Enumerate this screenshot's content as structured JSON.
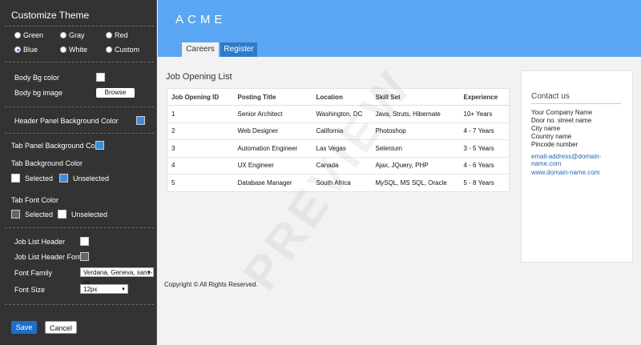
{
  "sidebar": {
    "title": "Customize Theme",
    "themes": [
      {
        "label": "Green",
        "selected": false
      },
      {
        "label": "Gray",
        "selected": false
      },
      {
        "label": "Red",
        "selected": false
      },
      {
        "label": "Blue",
        "selected": true
      },
      {
        "label": "White",
        "selected": false
      },
      {
        "label": "Custom",
        "selected": false
      }
    ],
    "body_bg_color_label": "Body Bg color",
    "body_bg_image_label": "Body bg image",
    "browse_label": "Browse",
    "header_panel_bg_label": "Header Panel Background Color",
    "tab_panel_bg_label": "Tab Panel Background Color",
    "tab_bg_label": "Tab Background Color",
    "selected_label": "Selected",
    "unselected_label": "Unselected",
    "tab_font_color_label": "Tab Font Color",
    "job_list_header_label": "Job List Header",
    "job_list_header_font_label": "Job List Header Font",
    "font_family_label": "Font Family",
    "font_family_value": "Verdana, Geneva, sans-se",
    "font_size_label": "Font Size",
    "font_size_value": "12px",
    "save_label": "Save",
    "cancel_label": "Cancel"
  },
  "colors": {
    "sidebar_bg": "#333333",
    "header_bg": "#5aa6f2",
    "accent_blue": "#3b8de0",
    "white": "#ffffff",
    "gray": "#666666"
  },
  "header": {
    "brand": "ACME",
    "tabs": [
      {
        "label": "Careers",
        "active": true
      },
      {
        "label": "Register",
        "active": false
      }
    ]
  },
  "main": {
    "list_title": "Job Opening List",
    "columns": [
      "Job Opening ID",
      "Posting Title",
      "Location",
      "Skill Set",
      "Experience"
    ],
    "rows": [
      [
        "1",
        "Senior Architect",
        "Washington, DC",
        "Java, Struts, Hibernate",
        "10+ Years"
      ],
      [
        "2",
        "Web Designer",
        "California",
        "Photoshop",
        "4 - 7 Years"
      ],
      [
        "3",
        "Automation Engineer",
        "Las Vegas",
        "Selenium",
        "3 - 5 Years"
      ],
      [
        "4",
        "UX Engineer",
        "Canada",
        "Ajax, JQuery, PHP",
        "4 - 6 Years"
      ],
      [
        "5",
        "Database Manager",
        "South Africa",
        "MySQL, MS SQL, Oracle",
        "5 - 8 Years"
      ]
    ],
    "footer": "Copyright © All Rights Reserved."
  },
  "contact": {
    "title": "Contact us",
    "lines": [
      "Your Company Name",
      "Door no. street name",
      "City name",
      "Country name",
      "Pincode number"
    ],
    "email": "email-address@domain-name.com",
    "website": "www.domain-name.com"
  },
  "watermark": "PREVIEW"
}
